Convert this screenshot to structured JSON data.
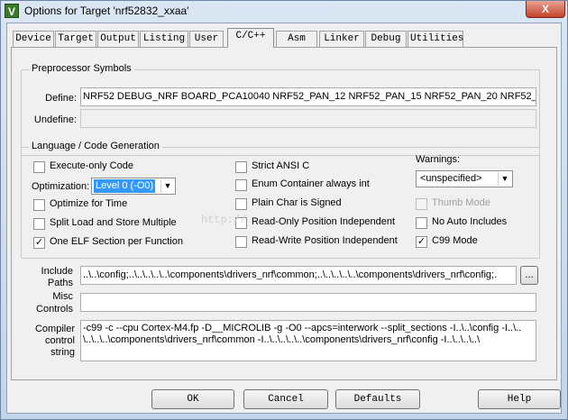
{
  "window": {
    "title": "Options for Target 'nrf52832_xxaa'",
    "close": "X",
    "app_icon": "V"
  },
  "tabs": [
    {
      "label": "Device"
    },
    {
      "label": "Target"
    },
    {
      "label": "Output"
    },
    {
      "label": "Listing"
    },
    {
      "label": "User"
    },
    {
      "label": "C/C++"
    },
    {
      "label": "Asm"
    },
    {
      "label": "Linker"
    },
    {
      "label": "Debug"
    },
    {
      "label": "Utilities"
    }
  ],
  "active_tab": "C/C++",
  "preprocessor": {
    "legend": "Preprocessor Symbols",
    "define_label": "Define:",
    "define_value": "NRF52 DEBUG_NRF BOARD_PCA10040 NRF52_PAN_12 NRF52_PAN_15 NRF52_PAN_20 NRF52_P",
    "undefine_label": "Undefine:",
    "undefine_value": ""
  },
  "language": {
    "legend": "Language / Code Generation",
    "execute_only": {
      "label": "Execute-only Code",
      "checked": false
    },
    "optimization_label": "Optimization:",
    "optimization_value": "Level 0 (-O0)",
    "optimize_time": {
      "label": "Optimize for Time",
      "checked": false
    },
    "split_load": {
      "label": "Split Load and Store Multiple",
      "checked": false
    },
    "one_elf": {
      "label": "One ELF Section per Function",
      "checked": true
    },
    "strict_ansi": {
      "label": "Strict ANSI C",
      "checked": false
    },
    "enum_container": {
      "label": "Enum Container always int",
      "checked": false
    },
    "plain_char": {
      "label": "Plain Char is Signed",
      "checked": false
    },
    "ro_pi": {
      "label": "Read-Only Position Independent",
      "checked": false
    },
    "rw_pi": {
      "label": "Read-Write Position Independent",
      "checked": false
    },
    "warnings_label": "Warnings:",
    "warnings_value": "<unspecified>",
    "thumb_mode": {
      "label": "Thumb Mode",
      "checked": false,
      "disabled": true
    },
    "no_auto_includes": {
      "label": "No Auto Includes",
      "checked": false
    },
    "c99_mode": {
      "label": "C99 Mode",
      "checked": true
    }
  },
  "include": {
    "label_1": "Include",
    "label_2": "Paths",
    "value": "..\\..\\config;..\\..\\..\\..\\..\\components\\drivers_nrf\\common;..\\..\\..\\..\\..\\components\\drivers_nrf\\config;.",
    "browse": "..."
  },
  "misc": {
    "label_1": "Misc",
    "label_2": "Controls",
    "value": ""
  },
  "compiler": {
    "label_1": "Compiler",
    "label_2": "control",
    "label_3": "string",
    "line_1": "-c99 -c --cpu Cortex-M4.fp -D__MICROLIB -g -O0 --apcs=interwork --split_sections -I..\\..\\config -I..\\..",
    "line_2": "\\..\\..\\..\\components\\drivers_nrf\\common -I..\\..\\..\\..\\..\\components\\drivers_nrf\\config -I..\\..\\..\\..\\"
  },
  "buttons": {
    "ok": "OK",
    "cancel": "Cancel",
    "defaults": "Defaults",
    "help": "Help"
  },
  "watermark": "http://"
}
